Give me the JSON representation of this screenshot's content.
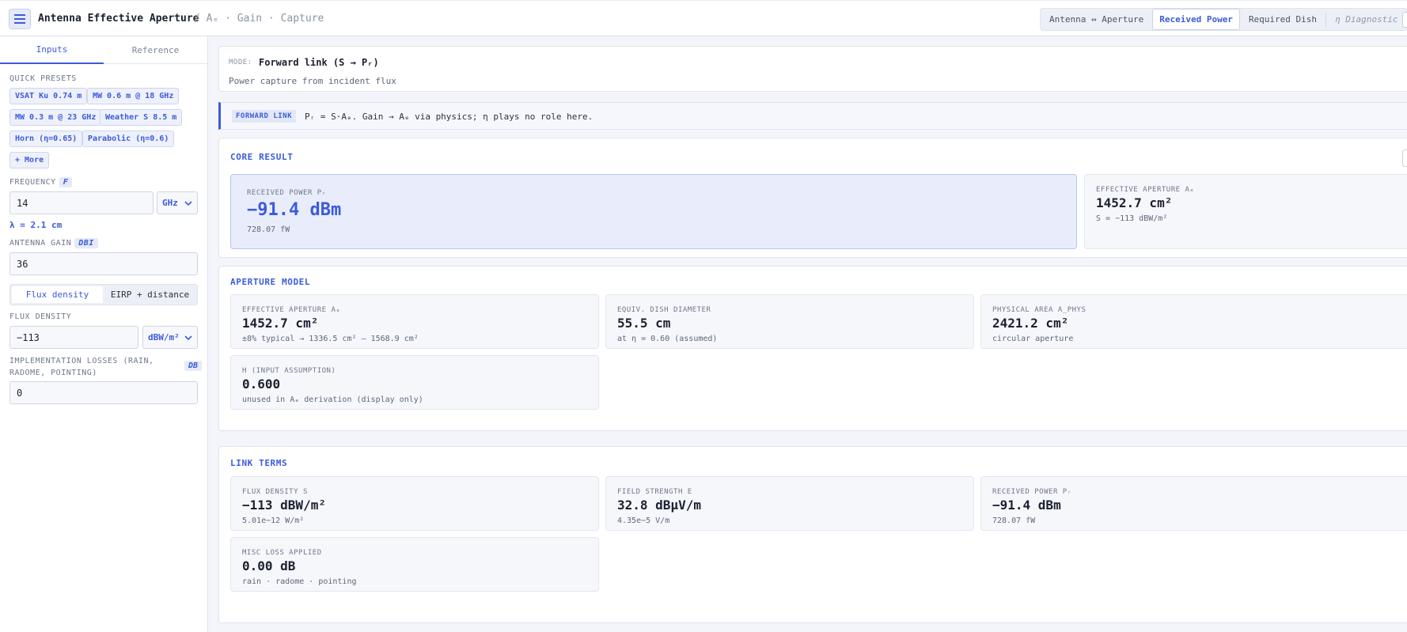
{
  "header": {
    "title": "Antenna Effective Aperture",
    "breadcrumb": "/ Aₑ · Gain · Capture",
    "mode_tabs": [
      {
        "label": "Antenna ↔ Aperture"
      },
      {
        "label": "Received Power"
      },
      {
        "label": "Required Dish"
      },
      {
        "label": "η Diagnostic"
      }
    ]
  },
  "sidebar": {
    "tabs": [
      {
        "label": "Inputs"
      },
      {
        "label": "Reference"
      }
    ],
    "presets_label": "QUICK PRESETS",
    "presets": [
      {
        "label": "VSAT Ku 0.74 m"
      },
      {
        "label": "MW 0.6 m @ 18 GHz"
      },
      {
        "label": "MW 0.3 m @ 23 GHz"
      },
      {
        "label": "Weather S 8.5 m"
      },
      {
        "label": "Horn (η=0.65)"
      },
      {
        "label": "Parabolic (η=0.6)"
      },
      {
        "label": "+ More"
      }
    ],
    "frequency": {
      "label": "FREQUENCY",
      "tag": "F",
      "value": "14",
      "unit": "GHz"
    },
    "wavelength": "λ = 2.1 cm",
    "gain": {
      "label": "ANTENNA GAIN",
      "tag": "DBI",
      "value": "36"
    },
    "mode_toggle": [
      {
        "label": "Flux density"
      },
      {
        "label": "EIRP + distance"
      }
    ],
    "flux": {
      "label": "FLUX DENSITY",
      "value": "−113",
      "unit": "dBW/m²"
    },
    "losses": {
      "label": "IMPLEMENTATION LOSSES (RAIN, RADOME, POINTING)",
      "tag": "DB",
      "value": "0"
    }
  },
  "main": {
    "mode": {
      "key": "MODE:",
      "value": "Forward link (S → Pᵣ)",
      "desc": "Power capture from incident flux"
    },
    "banner": {
      "tag": "FORWARD LINK",
      "text": "Pᵣ = S·Aₑ. Gain → Aₑ via physics; η plays no role here."
    },
    "core": {
      "title": "CORE RESULT",
      "hero": {
        "label": "RECEIVED POWER Pᵣ",
        "value": "−91.4 dBm",
        "sub": "728.07 fW"
      },
      "side": {
        "label": "EFFECTIVE APERTURE Aₑ",
        "value": "1452.7 cm²",
        "sub": "S = −113 dBW/m²"
      }
    },
    "aperture": {
      "title": "APERTURE MODEL",
      "cards": [
        {
          "label": "EFFECTIVE APERTURE Aₑ",
          "value": "1452.7 cm²",
          "sub": "±8% typical → 1336.5 cm² – 1568.9 cm²"
        },
        {
          "label": "EQUIV. DISH DIAMETER",
          "value": "55.5 cm",
          "sub": "at η = 0.60 (assumed)"
        },
        {
          "label": "PHYSICAL AREA A_PHYS",
          "value": "2421.2 cm²",
          "sub": "circular aperture"
        },
        {
          "label": "Η (INPUT ASSUMPTION)",
          "value": "0.600",
          "sub": "unused in Aₑ derivation (display only)"
        }
      ]
    },
    "link": {
      "title": "LINK TERMS",
      "cards": [
        {
          "label": "FLUX DENSITY S",
          "value": "−113 dBW/m²",
          "sub": "5.01e−12 W/m²"
        },
        {
          "label": "FIELD STRENGTH E",
          "value": "32.8 dBµV/m",
          "sub": "4.35e−5 V/m"
        },
        {
          "label": "RECEIVED POWER Pᵣ",
          "value": "−91.4 dBm",
          "sub": "728.07 fW"
        },
        {
          "label": "MISC LOSS APPLIED",
          "value": "0.00 dB",
          "sub": "rain · radome · pointing"
        }
      ]
    }
  },
  "icons": {
    "menu": "hamburger-menu-icon",
    "dropdown": "chevron-down-icon"
  },
  "colors": {
    "accent": "#3b5bdb",
    "background": "#f3f5fa",
    "hero_bg": "#e9edfb"
  }
}
